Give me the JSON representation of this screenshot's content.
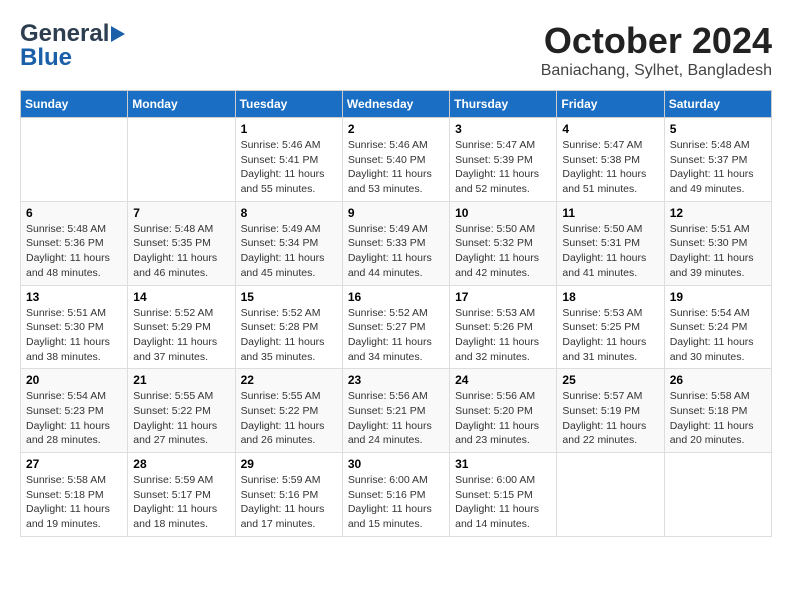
{
  "header": {
    "logo_line1": "General",
    "logo_line2": "Blue",
    "month": "October 2024",
    "location": "Baniachang, Sylhet, Bangladesh"
  },
  "weekdays": [
    "Sunday",
    "Monday",
    "Tuesday",
    "Wednesday",
    "Thursday",
    "Friday",
    "Saturday"
  ],
  "weeks": [
    [
      {
        "day": "",
        "info": ""
      },
      {
        "day": "",
        "info": ""
      },
      {
        "day": "1",
        "info": "Sunrise: 5:46 AM\nSunset: 5:41 PM\nDaylight: 11 hours and 55 minutes."
      },
      {
        "day": "2",
        "info": "Sunrise: 5:46 AM\nSunset: 5:40 PM\nDaylight: 11 hours and 53 minutes."
      },
      {
        "day": "3",
        "info": "Sunrise: 5:47 AM\nSunset: 5:39 PM\nDaylight: 11 hours and 52 minutes."
      },
      {
        "day": "4",
        "info": "Sunrise: 5:47 AM\nSunset: 5:38 PM\nDaylight: 11 hours and 51 minutes."
      },
      {
        "day": "5",
        "info": "Sunrise: 5:48 AM\nSunset: 5:37 PM\nDaylight: 11 hours and 49 minutes."
      }
    ],
    [
      {
        "day": "6",
        "info": "Sunrise: 5:48 AM\nSunset: 5:36 PM\nDaylight: 11 hours and 48 minutes."
      },
      {
        "day": "7",
        "info": "Sunrise: 5:48 AM\nSunset: 5:35 PM\nDaylight: 11 hours and 46 minutes."
      },
      {
        "day": "8",
        "info": "Sunrise: 5:49 AM\nSunset: 5:34 PM\nDaylight: 11 hours and 45 minutes."
      },
      {
        "day": "9",
        "info": "Sunrise: 5:49 AM\nSunset: 5:33 PM\nDaylight: 11 hours and 44 minutes."
      },
      {
        "day": "10",
        "info": "Sunrise: 5:50 AM\nSunset: 5:32 PM\nDaylight: 11 hours and 42 minutes."
      },
      {
        "day": "11",
        "info": "Sunrise: 5:50 AM\nSunset: 5:31 PM\nDaylight: 11 hours and 41 minutes."
      },
      {
        "day": "12",
        "info": "Sunrise: 5:51 AM\nSunset: 5:30 PM\nDaylight: 11 hours and 39 minutes."
      }
    ],
    [
      {
        "day": "13",
        "info": "Sunrise: 5:51 AM\nSunset: 5:30 PM\nDaylight: 11 hours and 38 minutes."
      },
      {
        "day": "14",
        "info": "Sunrise: 5:52 AM\nSunset: 5:29 PM\nDaylight: 11 hours and 37 minutes."
      },
      {
        "day": "15",
        "info": "Sunrise: 5:52 AM\nSunset: 5:28 PM\nDaylight: 11 hours and 35 minutes."
      },
      {
        "day": "16",
        "info": "Sunrise: 5:52 AM\nSunset: 5:27 PM\nDaylight: 11 hours and 34 minutes."
      },
      {
        "day": "17",
        "info": "Sunrise: 5:53 AM\nSunset: 5:26 PM\nDaylight: 11 hours and 32 minutes."
      },
      {
        "day": "18",
        "info": "Sunrise: 5:53 AM\nSunset: 5:25 PM\nDaylight: 11 hours and 31 minutes."
      },
      {
        "day": "19",
        "info": "Sunrise: 5:54 AM\nSunset: 5:24 PM\nDaylight: 11 hours and 30 minutes."
      }
    ],
    [
      {
        "day": "20",
        "info": "Sunrise: 5:54 AM\nSunset: 5:23 PM\nDaylight: 11 hours and 28 minutes."
      },
      {
        "day": "21",
        "info": "Sunrise: 5:55 AM\nSunset: 5:22 PM\nDaylight: 11 hours and 27 minutes."
      },
      {
        "day": "22",
        "info": "Sunrise: 5:55 AM\nSunset: 5:22 PM\nDaylight: 11 hours and 26 minutes."
      },
      {
        "day": "23",
        "info": "Sunrise: 5:56 AM\nSunset: 5:21 PM\nDaylight: 11 hours and 24 minutes."
      },
      {
        "day": "24",
        "info": "Sunrise: 5:56 AM\nSunset: 5:20 PM\nDaylight: 11 hours and 23 minutes."
      },
      {
        "day": "25",
        "info": "Sunrise: 5:57 AM\nSunset: 5:19 PM\nDaylight: 11 hours and 22 minutes."
      },
      {
        "day": "26",
        "info": "Sunrise: 5:58 AM\nSunset: 5:18 PM\nDaylight: 11 hours and 20 minutes."
      }
    ],
    [
      {
        "day": "27",
        "info": "Sunrise: 5:58 AM\nSunset: 5:18 PM\nDaylight: 11 hours and 19 minutes."
      },
      {
        "day": "28",
        "info": "Sunrise: 5:59 AM\nSunset: 5:17 PM\nDaylight: 11 hours and 18 minutes."
      },
      {
        "day": "29",
        "info": "Sunrise: 5:59 AM\nSunset: 5:16 PM\nDaylight: 11 hours and 17 minutes."
      },
      {
        "day": "30",
        "info": "Sunrise: 6:00 AM\nSunset: 5:16 PM\nDaylight: 11 hours and 15 minutes."
      },
      {
        "day": "31",
        "info": "Sunrise: 6:00 AM\nSunset: 5:15 PM\nDaylight: 11 hours and 14 minutes."
      },
      {
        "day": "",
        "info": ""
      },
      {
        "day": "",
        "info": ""
      }
    ]
  ]
}
